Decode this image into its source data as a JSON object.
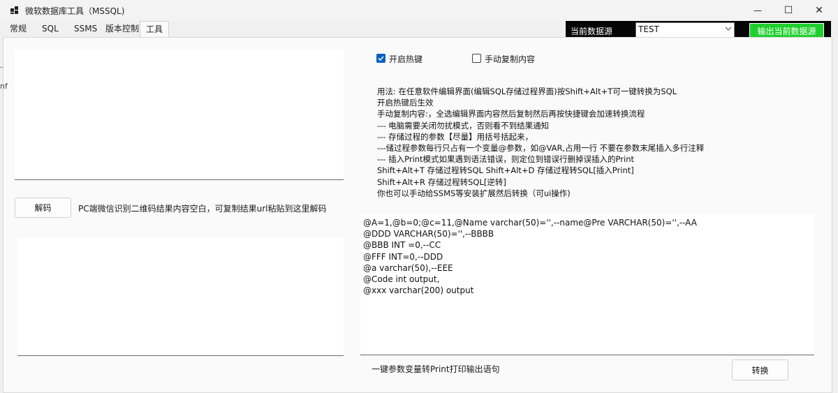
{
  "window": {
    "title": "微软数据库工具（MSSQL)",
    "minimize_glyph": "—",
    "maximize_glyph": "☐",
    "close_glyph": "✕"
  },
  "tabs": [
    {
      "label": "常规"
    },
    {
      "label": "SQL"
    },
    {
      "label": "SSMS"
    },
    {
      "label": "版本控制"
    },
    {
      "label": "工具",
      "active": true
    }
  ],
  "datasource": {
    "label": "当前数据源",
    "selected": "TEST",
    "export_label": "输出当前数据源",
    "export_color": "#1fcf2d"
  },
  "decode": {
    "button_label": "解码",
    "hint": "PC端微信识别二维码结果内容空白，可复制结果url粘贴到这里解码"
  },
  "options": {
    "hotkey_label": "开启热键",
    "hotkey_checked": true,
    "manual_copy_label": "手动复制内容",
    "manual_copy_checked": false
  },
  "instructions": [
    "用法: 在任意软件编辑界面(编辑SQL存储过程界面)按Shift+Alt+T可一键转换为SQL",
    "开启热键后生效",
    "手动复制内容:，全选编辑界面内容然后复制然后再按快捷键会加速转换流程",
    "--- 电脑需要关闭勿扰模式，否则看不到结果通知",
    "--- 存储过程的参数【尽量】用括号括起来，",
    "---储过程参数每行只占有一个变量@参数，如@VAR,占用一行 不要在参数末尾插入多行注释",
    "--- 插入Print模式如果遇到语法错误，则定位到错误行删掉误插入的Print",
    "Shift+Alt+T 存储过程转SQL Shift+Alt+D 存储过程转SQL[插入Print]",
    "Shift+Alt+R 存储过程转SQL[逆转]",
    "你也可以手动给SSMS等安装扩展然后转换（可ui操作)"
  ],
  "sql_params": [
    "@A=1,@b=0;@c=11,@Name varchar(50)='',--name@Pre VARCHAR(50)='',--AA",
    "@DDD VARCHAR(50)='',--BBBB",
    "@BBB INT =0,--CC",
    "@FFF INT=0,--DDD",
    "@a varchar(50),--EEE",
    "@Code int output,",
    "@xxx varchar(200) output"
  ],
  "convert": {
    "hint": "一键参数变量转Print打印输出语句",
    "button_label": "转换"
  },
  "edge_text": "nf"
}
